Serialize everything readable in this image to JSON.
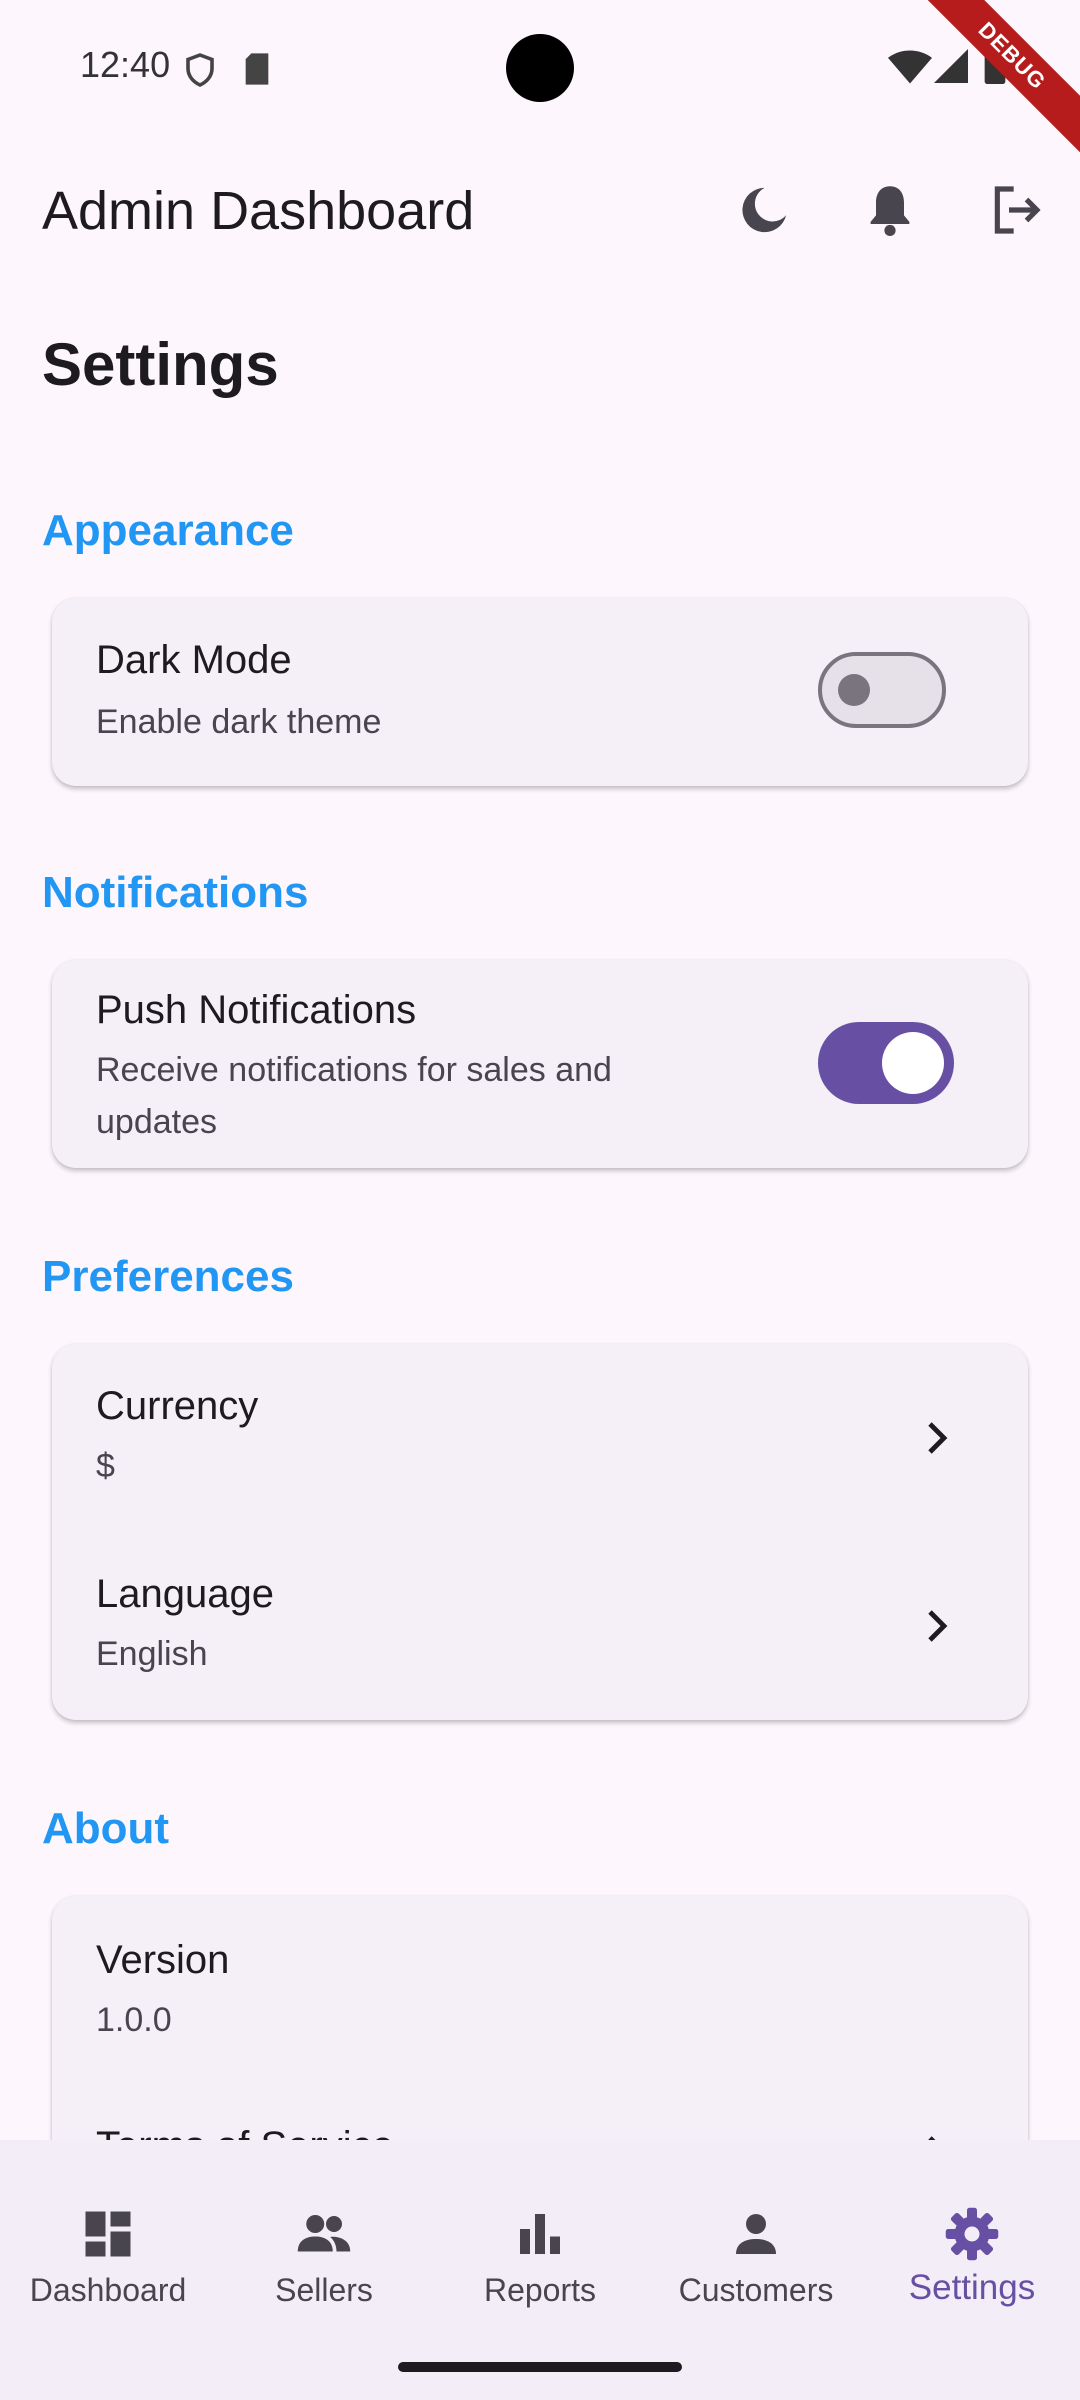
{
  "status_bar": {
    "time": "12:40",
    "debug_label": "DEBUG"
  },
  "app_bar": {
    "title": "Admin Dashboard",
    "icons": [
      "dark-mode-icon",
      "notifications-icon",
      "logout-icon"
    ]
  },
  "page": {
    "title": "Settings"
  },
  "sections": {
    "appearance": {
      "title": "Appearance",
      "dark_mode": {
        "title": "Dark Mode",
        "subtitle": "Enable dark theme",
        "enabled": false
      }
    },
    "notifications": {
      "title": "Notifications",
      "push": {
        "title": "Push Notifications",
        "subtitle_line1": "Receive notifications for sales and",
        "subtitle_line2": "updates",
        "enabled": true
      }
    },
    "preferences": {
      "title": "Preferences",
      "currency": {
        "title": "Currency",
        "value": "$"
      },
      "language": {
        "title": "Language",
        "value": "English"
      }
    },
    "about": {
      "title": "About",
      "version": {
        "title": "Version",
        "value": "1.0.0"
      },
      "terms": {
        "title": "Terms of Service"
      }
    }
  },
  "bottom_nav": {
    "items": [
      {
        "label": "Dashboard",
        "icon": "dashboard-icon"
      },
      {
        "label": "Sellers",
        "icon": "people-icon"
      },
      {
        "label": "Reports",
        "icon": "bar-chart-icon"
      },
      {
        "label": "Customers",
        "icon": "person-icon"
      },
      {
        "label": "Settings",
        "icon": "gear-icon"
      }
    ],
    "active_index": 4
  },
  "colors": {
    "accent": "#6750a4",
    "section_title": "#2196f3",
    "background": "#fdf7fd",
    "card": "#f5eff7"
  }
}
